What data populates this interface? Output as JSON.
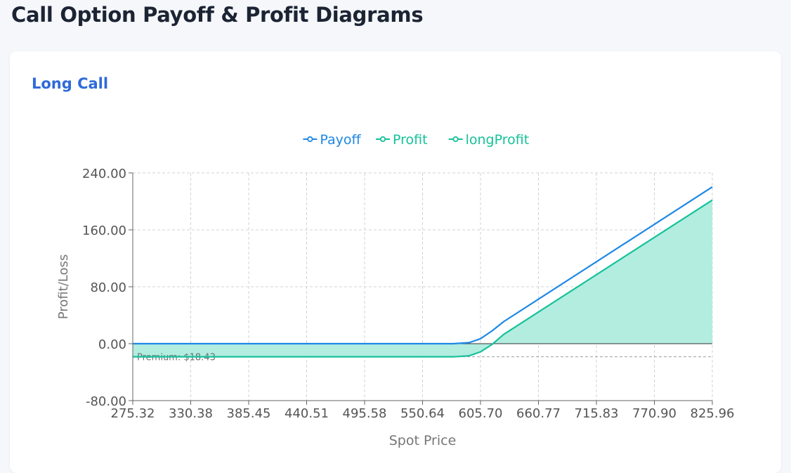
{
  "page": {
    "title": "Call Option Payoff & Profit Diagrams"
  },
  "card": {
    "title": "Long Call"
  },
  "chart_data": {
    "type": "line",
    "title": "",
    "xlabel": "Spot Price",
    "ylabel": "Profit/Loss",
    "xlim": [
      275.32,
      825.96
    ],
    "ylim": [
      -80,
      240
    ],
    "x_ticks": [
      "275.32",
      "330.38",
      "385.45",
      "440.51",
      "495.58",
      "550.64",
      "605.70",
      "660.77",
      "715.83",
      "770.90",
      "825.96"
    ],
    "y_ticks": [
      "240.00",
      "160.00",
      "80.00",
      "0.00",
      "-80.00"
    ],
    "grid": true,
    "legend_position": "top-center",
    "strike": 605.7,
    "premium": 18.43,
    "premium_label": "Premium: $18.43",
    "colors": {
      "payoff": "#1e88e5",
      "profit": "#16c19a",
      "fill": "#b2ede0"
    },
    "series": [
      {
        "name": "Payoff",
        "x": [
          275.32,
          580,
          595,
          605.7,
          616.71,
          627.72,
          825.96
        ],
        "y": [
          0,
          0,
          1.5,
          7,
          18,
          31,
          220.26
        ]
      },
      {
        "name": "Profit",
        "x": [
          275.32,
          580,
          595,
          605.7,
          616.71,
          627.72,
          825.96
        ],
        "y": [
          -18.43,
          -18.43,
          -17,
          -11.5,
          -1,
          13,
          201.83
        ]
      },
      {
        "name": "longProfit",
        "x": [
          275.32,
          580,
          595,
          605.7,
          616.71,
          627.72,
          825.96
        ],
        "y": [
          -18.43,
          -18.43,
          -17,
          -11.5,
          -1,
          13,
          201.83
        ]
      }
    ]
  }
}
